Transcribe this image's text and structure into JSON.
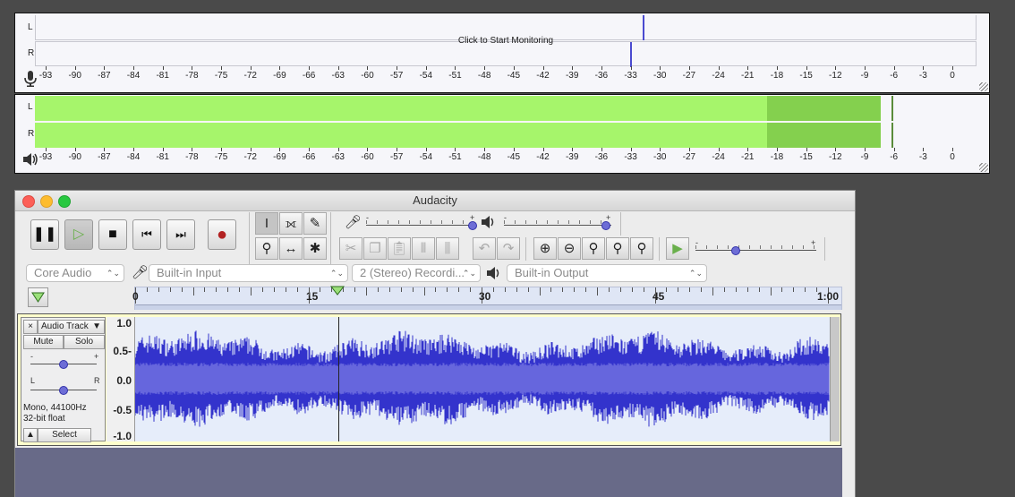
{
  "recording_meter": {
    "channels": [
      "L",
      "R"
    ],
    "prompt": "Click to Start Monitoring",
    "icon": "microphone-icon",
    "scale": [
      "-93",
      "-90",
      "-87",
      "-84",
      "-81",
      "-78",
      "-75",
      "-72",
      "-69",
      "-66",
      "-63",
      "-60",
      "-57",
      "-54",
      "-51",
      "-48",
      "-45",
      "-42",
      "-39",
      "-36",
      "-33",
      "-30",
      "-27",
      "-24",
      "-21",
      "-18",
      "-15",
      "-12",
      "-9",
      "-6",
      "-3",
      "0"
    ]
  },
  "playback_meter": {
    "channels": [
      "L",
      "R"
    ],
    "icon": "speaker-icon",
    "level_db": -19.0,
    "peak_db": -7.3,
    "hold_db": -6.2,
    "colors": {
      "level": "#a6f56b",
      "peak": "#84d04e",
      "hold": "#5a8c3a"
    },
    "scale": [
      "-93",
      "-90",
      "-87",
      "-84",
      "-81",
      "-78",
      "-75",
      "-72",
      "-69",
      "-66",
      "-63",
      "-60",
      "-57",
      "-54",
      "-51",
      "-48",
      "-45",
      "-42",
      "-39",
      "-36",
      "-33",
      "-30",
      "-27",
      "-24",
      "-21",
      "-18",
      "-15",
      "-12",
      "-9",
      "-6",
      "-3",
      "0"
    ]
  },
  "window": {
    "title": "Audacity"
  },
  "devices": {
    "host": "Core Audio",
    "input": "Built-in Input",
    "channels": "2 (Stereo) Recordi...",
    "output": "Built-in Output"
  },
  "timeline": {
    "labels": [
      "0",
      "15",
      "30",
      "45",
      "1:00"
    ]
  },
  "track": {
    "name": "Audio Track",
    "mute": "Mute",
    "solo": "Solo",
    "gain_minus": "-",
    "gain_plus": "+",
    "pan_left": "L",
    "pan_right": "R",
    "rate": "Mono, 44100Hz",
    "format": "32-bit float",
    "select": "Select",
    "scale": [
      "1.0",
      "0.5-",
      "0.0",
      "-0.5",
      "-1.0"
    ]
  },
  "colors": {
    "wave": "#3333cc",
    "wave_rms": "#6666dd",
    "wave_bg": "#e6edfa"
  }
}
